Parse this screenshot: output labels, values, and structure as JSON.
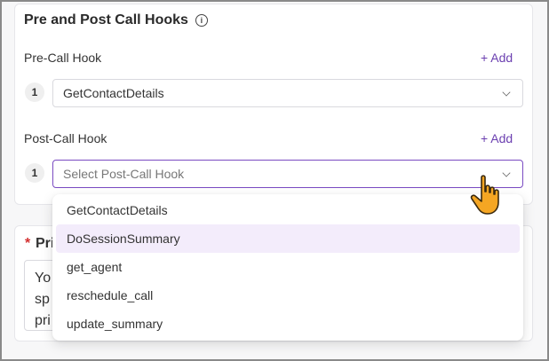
{
  "section": {
    "title": "Pre and Post Call Hooks",
    "info_icon": "info-icon"
  },
  "pre_call": {
    "label": "Pre-Call Hook",
    "add_label": "+ Add",
    "items": [
      {
        "index": "1",
        "value": "GetContactDetails"
      }
    ]
  },
  "post_call": {
    "label": "Post-Call Hook",
    "add_label": "+ Add",
    "items": [
      {
        "index": "1",
        "placeholder": "Select Post-Call Hook",
        "value": ""
      }
    ]
  },
  "dropdown": {
    "options": [
      "GetContactDetails",
      "DoSessionSummary",
      "get_agent",
      "reschedule_call",
      "update_summary"
    ],
    "hovered": "DoSessionSummary"
  },
  "prompt_section": {
    "required_mark": "*",
    "label_partial": "Pri",
    "text_lines": [
      "Yo",
      "sp",
      "pri"
    ]
  },
  "colors": {
    "accent": "#7a4bc2",
    "link": "#6b3fb0",
    "required": "#d32f2f",
    "hover_bg": "#f3ecfb",
    "cursor": "#f5a623"
  }
}
